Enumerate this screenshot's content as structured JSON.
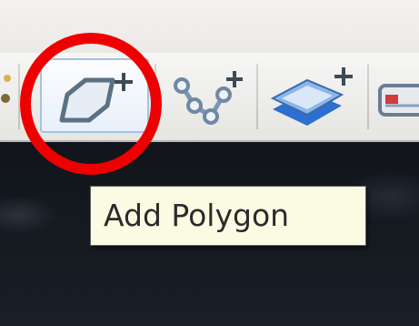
{
  "toolbar": {
    "buttons": [
      {
        "name": "add-polygon-button",
        "icon": "polygon-add-icon",
        "active": true
      },
      {
        "name": "add-line-button",
        "icon": "polyline-add-icon",
        "active": false
      },
      {
        "name": "add-layer-button",
        "icon": "layer-add-icon",
        "active": false
      },
      {
        "name": "next-tool-button",
        "icon": "toolbar-icon",
        "active": false
      }
    ]
  },
  "tooltip": {
    "text": "Add Polygon"
  },
  "annotation": {
    "color": "#ee0000",
    "shape": "circle"
  }
}
